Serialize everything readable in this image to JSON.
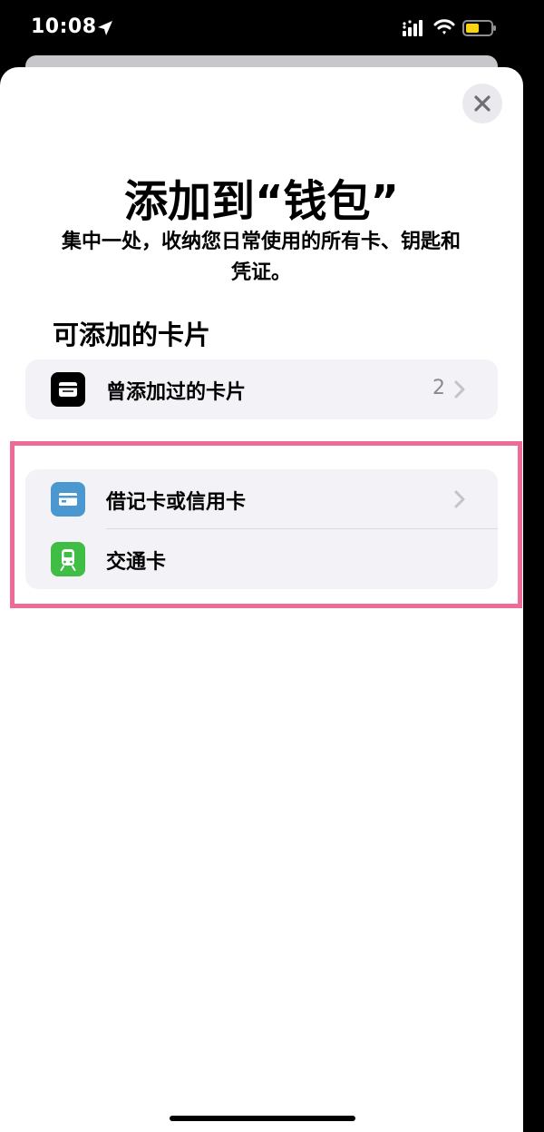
{
  "status_bar": {
    "time": "10:08"
  },
  "header": {
    "title": "添加到“钱包”",
    "subtitle": "集中一处，收纳您日常使用的所有卡、钥匙和凭证。"
  },
  "section": {
    "heading": "可添加的卡片"
  },
  "previous_cards": {
    "label": "曾添加过的卡片",
    "count": "2",
    "icon": "wallet-icon"
  },
  "card_types": [
    {
      "label": "借记卡或信用卡",
      "icon": "credit-card-icon",
      "color": "#4a98cf"
    },
    {
      "label": "交通卡",
      "icon": "train-icon",
      "color": "#3fbd45"
    }
  ],
  "colors": {
    "highlight": "#ee6b98",
    "row_background": "#f2f2f7"
  }
}
